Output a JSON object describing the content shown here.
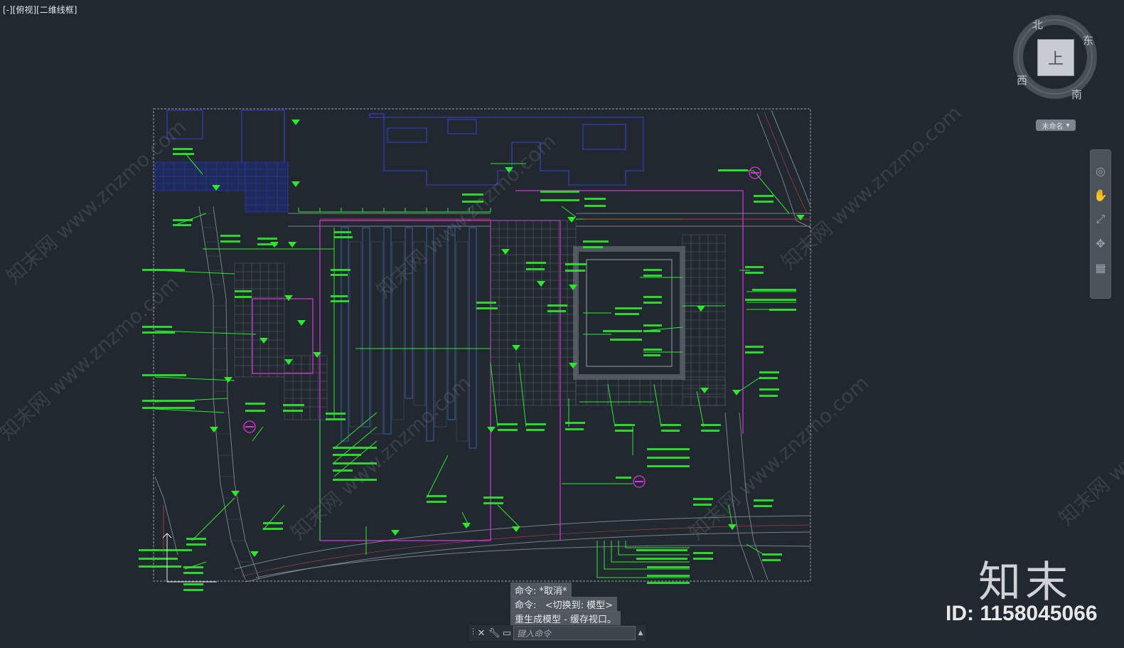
{
  "viewport": {
    "label": "[-][俯视][二维线框]"
  },
  "viewcube": {
    "face": "上",
    "north": "北",
    "east": "东",
    "south": "南",
    "west": "西",
    "ucs_label": "未命名"
  },
  "navbar": {
    "tools": [
      "steering-wheel-icon",
      "pan-icon",
      "zoom-icon",
      "orbit-icon",
      "showmotion-icon"
    ]
  },
  "command": {
    "history": [
      "命令: *取消*",
      "命令:   <切换到: 模型>",
      "重生成模型 - 缓存视口。"
    ],
    "input_placeholder": "键入命令"
  },
  "watermark": {
    "logo": "知末",
    "id": "ID: 1158045066",
    "diagonal": "知末网 www.znzmo.com"
  },
  "colors": {
    "background": "#212830",
    "cad_green": "#2ee82e",
    "cad_magenta": "#e62ee6",
    "cad_blue": "#2f3fd0",
    "cad_gray": "#8a8f96",
    "cad_red": "#d04040"
  }
}
